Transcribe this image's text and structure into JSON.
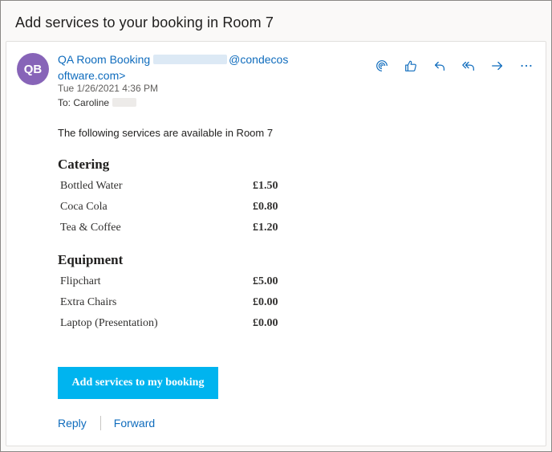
{
  "subject": "Add services to your booking in Room 7",
  "message": {
    "avatar_initials": "QB",
    "sender_name": "QA Room Booking",
    "sender_email_domain": "@condecos",
    "sender_email_cont": "oftware.com>",
    "date": "Tue 1/26/2021 4:36 PM",
    "to_label": "To:",
    "to_name": "Caroline"
  },
  "actions": [
    {
      "icon": "loop-icon"
    },
    {
      "icon": "like-icon"
    },
    {
      "icon": "reply-icon"
    },
    {
      "icon": "reply-all-icon"
    },
    {
      "icon": "forward-icon"
    },
    {
      "icon": "more-icon"
    }
  ],
  "body": {
    "intro": "The following services are available in Room 7",
    "catering_title": "Catering",
    "catering": [
      {
        "name": "Bottled Water",
        "price": "£1.50"
      },
      {
        "name": "Coca Cola",
        "price": "£0.80"
      },
      {
        "name": "Tea & Coffee",
        "price": "£1.20"
      }
    ],
    "equipment_title": "Equipment",
    "equipment": [
      {
        "name": "Flipchart",
        "price": "£5.00"
      },
      {
        "name": "Extra Chairs",
        "price": "£0.00"
      },
      {
        "name": "Laptop (Presentation)",
        "price": "£0.00"
      }
    ],
    "cta_label": "Add services to my booking"
  },
  "footer": {
    "reply_label": "Reply",
    "forward_label": "Forward"
  },
  "colors": {
    "accent": "#0f6cbd",
    "avatar": "#8764b8",
    "cta": "#00b4ef"
  }
}
